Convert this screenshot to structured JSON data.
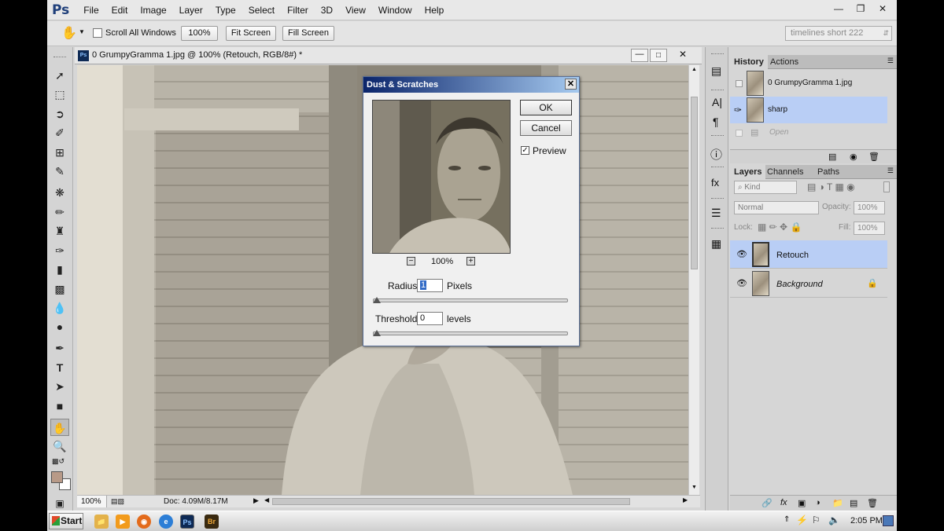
{
  "app": {
    "logo": "Ps",
    "menu": [
      "File",
      "Edit",
      "Image",
      "Layer",
      "Type",
      "Select",
      "Filter",
      "3D",
      "View",
      "Window",
      "Help"
    ],
    "window_controls": {
      "minimize": "—",
      "restore": "❐",
      "close": "✕"
    }
  },
  "options_bar": {
    "scroll_all_windows": "Scroll All Windows",
    "zoom_value": "100%",
    "fit_screen": "Fit Screen",
    "fill_screen": "Fill Screen",
    "workspace": "timelines short 222"
  },
  "document": {
    "tab_badge": "Ps",
    "title": "0 GrumpyGramma 1.jpg @ 100% (Retouch, RGB/8#) *",
    "zoom": "100%",
    "doc_info": "Doc: 4.09M/8.17M"
  },
  "history_panel": {
    "tabs": [
      "History",
      "Actions"
    ],
    "active_tab": "History",
    "snapshot_label": "0 GrumpyGramma 1.jpg",
    "items": [
      {
        "label": "sharp",
        "selected": true
      },
      {
        "label": "Open",
        "selected": false
      }
    ]
  },
  "layers_panel": {
    "tabs": [
      "Layers",
      "Channels",
      "Paths"
    ],
    "active_tab": "Layers",
    "kind_filter": "Kind",
    "blend_mode": "Normal",
    "opacity_label": "Opacity:",
    "opacity": "100%",
    "lock_label": "Lock:",
    "fill_label": "Fill:",
    "fill": "100%",
    "layers": [
      {
        "name": "Retouch",
        "selected": true,
        "locked": false
      },
      {
        "name": "Background",
        "selected": false,
        "locked": true
      }
    ]
  },
  "dialog": {
    "title": "Dust & Scratches",
    "ok": "OK",
    "cancel": "Cancel",
    "preview_label": "Preview",
    "preview_checked": true,
    "preview_zoom": "100%",
    "radius_label": "Radius:",
    "radius_value": "1",
    "radius_unit": "Pixels",
    "threshold_label": "Threshold:",
    "threshold_value": "0",
    "threshold_unit": "levels"
  },
  "taskbar": {
    "start": "Start",
    "clock": "2:05 PM"
  },
  "colors": {
    "selection": "#b9cef5",
    "dialog_title_start": "#0a246a",
    "dialog_title_end": "#a6caf0",
    "foreground_swatch": "#b89a88"
  }
}
